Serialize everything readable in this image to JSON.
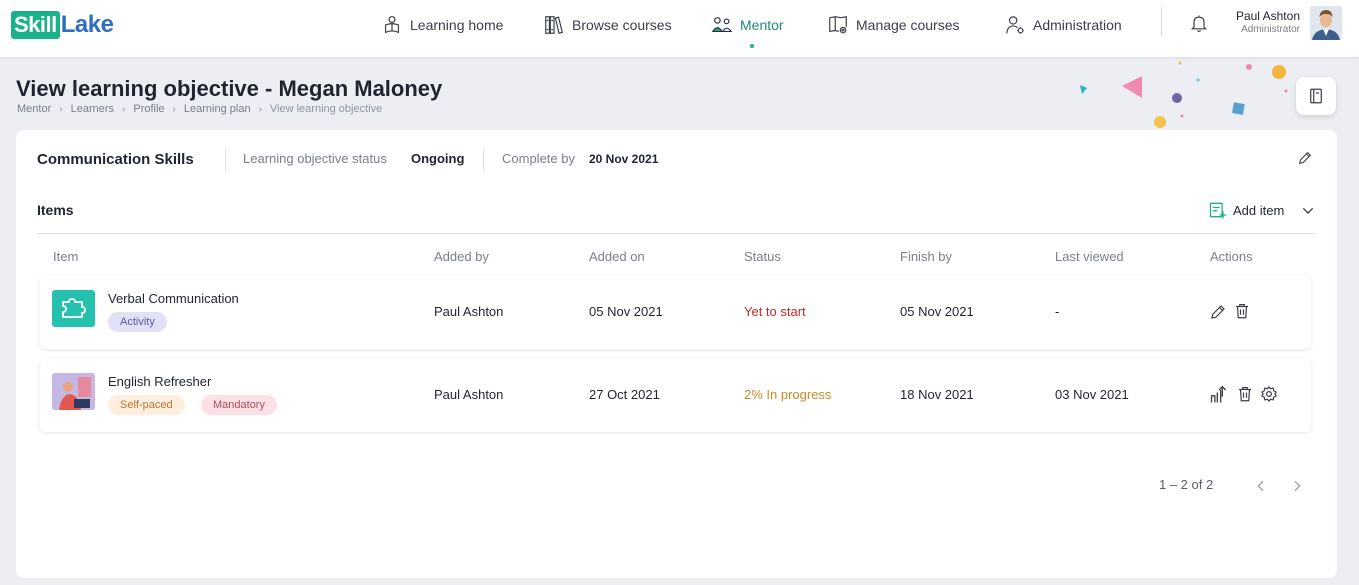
{
  "brand": {
    "part1": "Skill",
    "part2": "Lake",
    "green": "#1bb28a",
    "blue": "#2e6fc4"
  },
  "nav": {
    "items": [
      {
        "label": "Learning home",
        "icon": "learner-icon"
      },
      {
        "label": "Browse courses",
        "icon": "books-icon"
      },
      {
        "label": "Mentor",
        "icon": "mentor-icon",
        "active": true
      },
      {
        "label": "Manage courses",
        "icon": "manage-courses-icon"
      },
      {
        "label": "Administration",
        "icon": "admin-icon"
      }
    ]
  },
  "user": {
    "name": "Paul Ashton",
    "role": "Administrator"
  },
  "page": {
    "title": "View learning objective - Megan Maloney",
    "breadcrumb": [
      "Mentor",
      "Learners",
      "Profile",
      "Learning plan",
      "View learning objective"
    ]
  },
  "objective": {
    "name": "Communication Skills",
    "status_label": "Learning objective status",
    "status_value": "Ongoing",
    "complete_label": "Complete by",
    "complete_value": "20 Nov 2021"
  },
  "items": {
    "heading": "Items",
    "add_label": "Add item",
    "columns": [
      "Item",
      "Added by",
      "Added on",
      "Status",
      "Finish by",
      "Last viewed",
      "Actions"
    ],
    "rows": [
      {
        "name": "Verbal Communication",
        "tags": [
          "Activity"
        ],
        "added_by": "Paul Ashton",
        "added_on": "05 Nov 2021",
        "status": "Yet to start",
        "finish_by": "05 Nov 2021",
        "last_viewed": "-",
        "actions": [
          "edit-icon",
          "delete-icon"
        ]
      },
      {
        "name": "English Refresher",
        "tags": [
          "Self-paced",
          "Mandatory"
        ],
        "added_by": "Paul Ashton",
        "added_on": "27 Oct 2021",
        "status": "2% In progress",
        "finish_by": "18 Nov 2021",
        "last_viewed": "03 Nov 2021",
        "actions": [
          "share-icon",
          "delete-icon",
          "settings-icon"
        ]
      }
    ]
  },
  "pagination": {
    "range": "1 – 2 of 2"
  },
  "colors": {
    "status_yet": "#c62828",
    "status_progress": "#c78a22",
    "accent": "#1bb28a"
  }
}
